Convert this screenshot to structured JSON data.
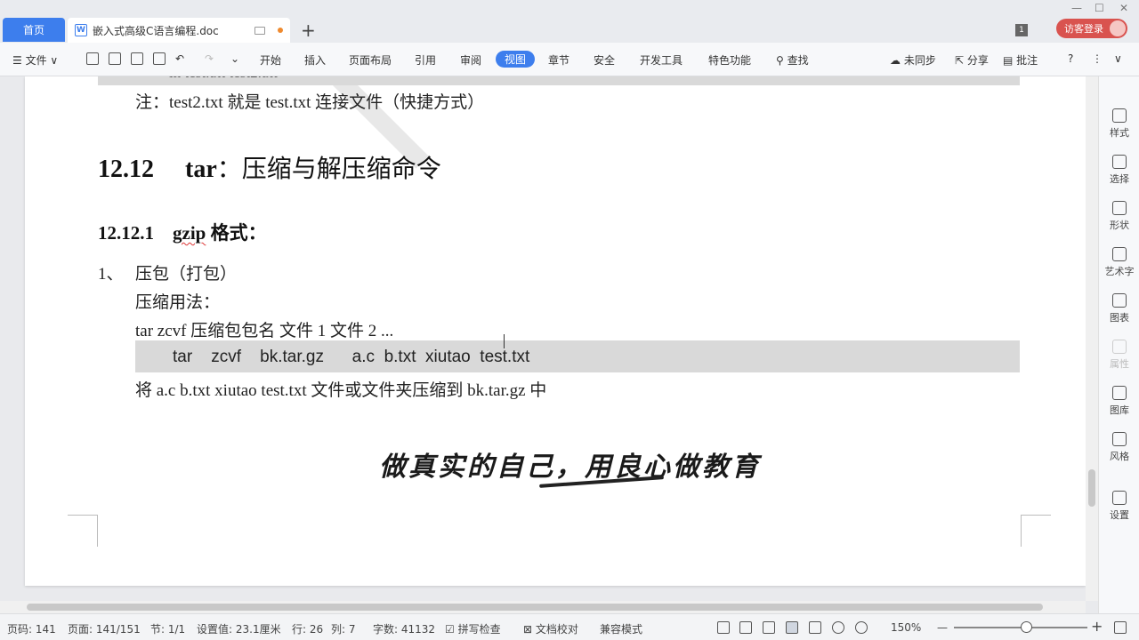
{
  "titlebar": {
    "home_tab": "首页",
    "doc_tab": "嵌入式高级C语言编程.doc",
    "doc_icon": "W",
    "new_tab": "+",
    "window_count": "1",
    "login": "访客登录",
    "min": "—",
    "max": "☐",
    "close": "✕"
  },
  "toolbar": {
    "menu": "☰ 文件 ∨",
    "tabs": [
      "开始",
      "插入",
      "页面布局",
      "引用",
      "审阅",
      "视图",
      "章节",
      "安全",
      "开发工具",
      "特色功能"
    ],
    "search": "查找",
    "sync": "未同步",
    "share": "分享",
    "comment": "批注",
    "help": "?",
    "more": "⋮",
    "collapse": "∨"
  },
  "document": {
    "note_line": "注：test2.txt  就是 test.txt  连接文件（快捷方式）",
    "h2_number": "12.12",
    "h2_cmd": "tar",
    "h2_text": "：压缩与解压缩命令",
    "h3_number": "12.12.1",
    "h3_cmd": "gzip",
    "h3_text": " 格式：",
    "item_number": "1、",
    "item_text": "压包（打包）",
    "usage_label": "压缩用法：",
    "usage_line": "tar zcvf  压缩包包名      文件 1    文件 2 ...",
    "code_line": "tar    zcvf    bk.tar.gz      a.c  b.txt  xiutao  test.txt",
    "explain_line": "将 a.c b.txt xiutao    test.txt    文件或文件夹压缩到  bk.tar.gz 中",
    "slogan": "做真实的自己，用良心做教育"
  },
  "sidepanel": {
    "items": [
      "样式",
      "选择",
      "形状",
      "艺术字",
      "图表",
      "属性",
      "图库",
      "风格",
      "设置"
    ]
  },
  "statusbar": {
    "page_code": "页码: 141",
    "page": "页面: 141/151",
    "section": "节: 1/1",
    "setting": "设置值: 23.1厘米",
    "row": "行: 26",
    "col": "列: 7",
    "words": "字数: 41132",
    "spell": "拼写检查",
    "proof": "文档校对",
    "compat": "兼容模式",
    "zoom": "150%",
    "zoom_out": "—",
    "zoom_in": "+"
  }
}
